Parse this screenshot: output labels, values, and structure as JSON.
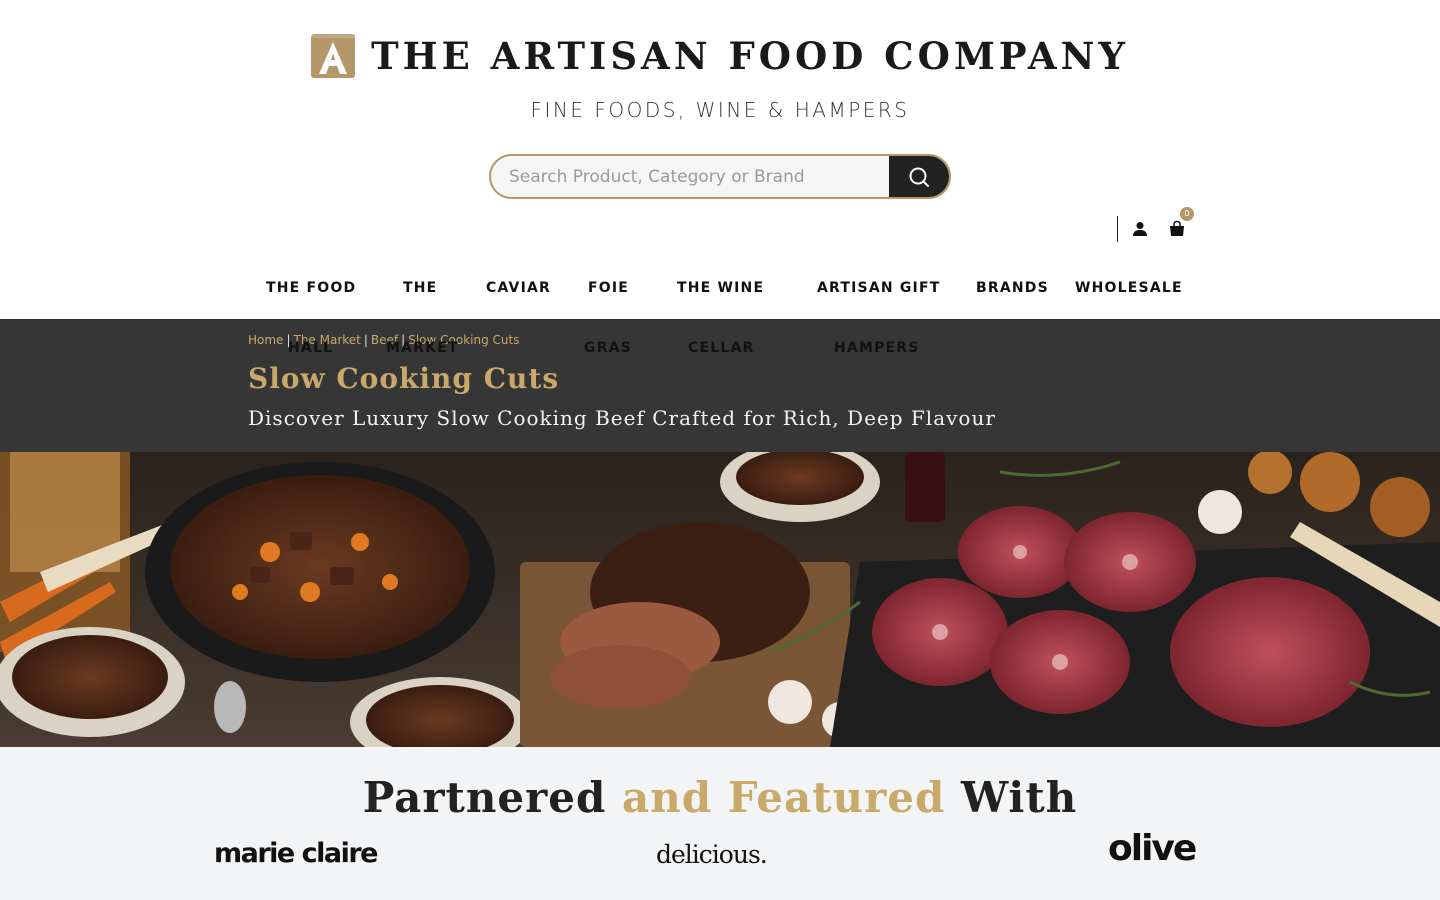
{
  "brand": {
    "name": "THE ARTISAN FOOD COMPANY",
    "tagline": "FINE FOODS, WINE & HAMPERS",
    "logo_letter": "A",
    "accent_color": "#b5976b"
  },
  "search": {
    "placeholder": "Search Product, Category or Brand",
    "button_icon": "search-icon"
  },
  "header_icons": {
    "account_icon": "user-icon",
    "cart_icon": "shopping-bag-icon",
    "cart_count": "0"
  },
  "nav": {
    "items": [
      {
        "line1": "THE FOOD",
        "line2": "HALL"
      },
      {
        "line1": "THE",
        "line2": "MARKET"
      },
      {
        "line1": "CAVIAR",
        "line2": ""
      },
      {
        "line1": "FOIE",
        "line2": "GRAS"
      },
      {
        "line1": "THE WINE",
        "line2": "CELLAR"
      },
      {
        "line1": "ARTISAN GIFT",
        "line2": "HAMPERS"
      },
      {
        "line1": "BRANDS",
        "line2": ""
      },
      {
        "line1": "WHOLESALE",
        "line2": ""
      }
    ]
  },
  "breadcrumb": [
    "Home",
    "The Market",
    "Beef",
    "Slow Cooking Cuts"
  ],
  "hero": {
    "title": "Slow Cooking Cuts",
    "subtitle": "Discover Luxury Slow Cooking Beef Crafted for Rich, Deep Flavour"
  },
  "partners": {
    "title_start": "Partnered ",
    "title_accent": "and Featured",
    "title_end": " With",
    "logos": [
      "marie claire",
      "delicious.",
      "olive"
    ]
  }
}
